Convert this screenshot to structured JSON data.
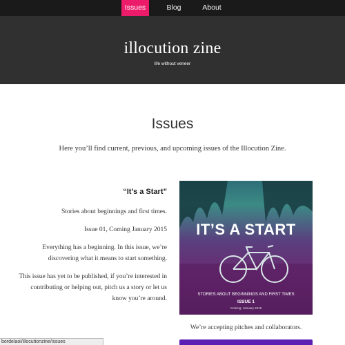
{
  "nav": {
    "items": [
      {
        "label": "Issues",
        "active": true
      },
      {
        "label": "Blog",
        "active": false
      },
      {
        "label": "About",
        "active": false
      }
    ],
    "active_color": "#ec1c6a"
  },
  "header": {
    "title": "illocution zine",
    "tagline": "life without veneer"
  },
  "main": {
    "title": "Issues",
    "intro": "Here you’ll find current, previous, and upcoming issues of the Illocution Zine."
  },
  "issue": {
    "title": "“It’s a Start”",
    "summary": "Stories about beginnings and first times.",
    "number_date": "Issue 01, Coming January 2015",
    "desc1": "Everything has a beginning. In this issue, we’re discovering what it means to start something.",
    "desc2": "This issue has yet to be published, if you’re interested in contributing or helping out, pitch us a story or let us know you’re around."
  },
  "cover": {
    "headline": "IT’S A START",
    "subtitle": "STORIES ABOUT BEGINNINGS AND FIRST TIMES",
    "issue_label": "ISSUE 1",
    "date": "Coming: January 2015"
  },
  "pitch_note": "We’re accepting pitches and collaborators.",
  "status_url": "bordelaoi/illocutionzine/issues",
  "button_color": "#5b1fb3"
}
